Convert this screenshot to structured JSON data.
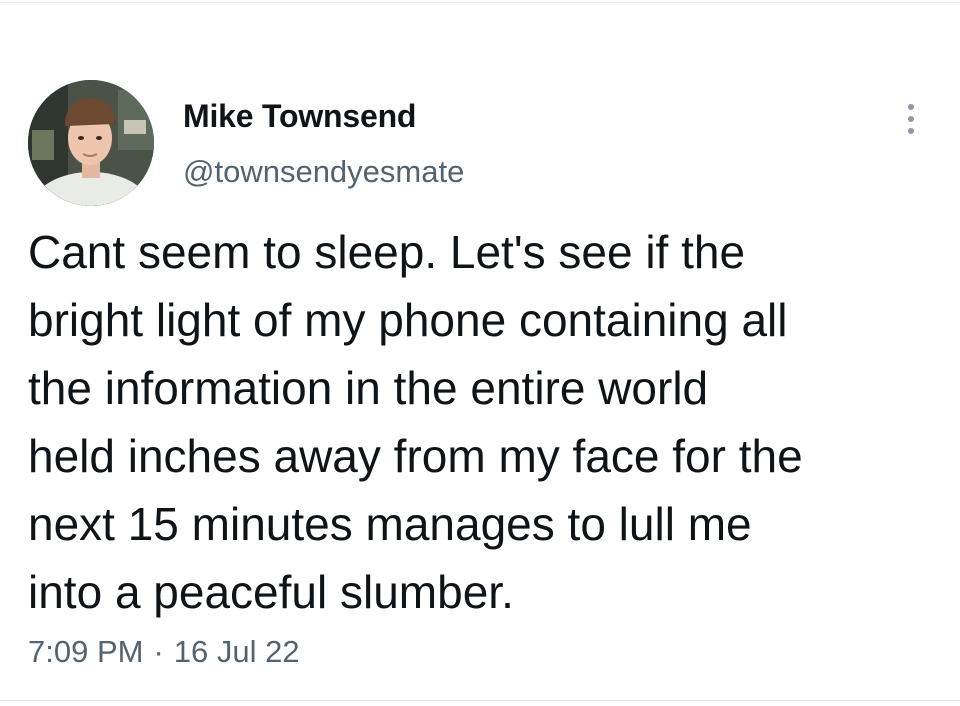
{
  "tweet": {
    "author": {
      "name": "Mike Townsend",
      "handle": "@townsendyesmate"
    },
    "text_lines": [
      "Cant seem to sleep. Let's see if the",
      "bright light of my phone containing all",
      "the information in the entire world",
      "held inches away from my face for the",
      "next 15 minutes manages to lull me",
      "into a peaceful slumber."
    ],
    "time": "7:09 PM",
    "separator": "·",
    "date": "16 Jul 22",
    "more_icon": "more-vertical-icon"
  }
}
